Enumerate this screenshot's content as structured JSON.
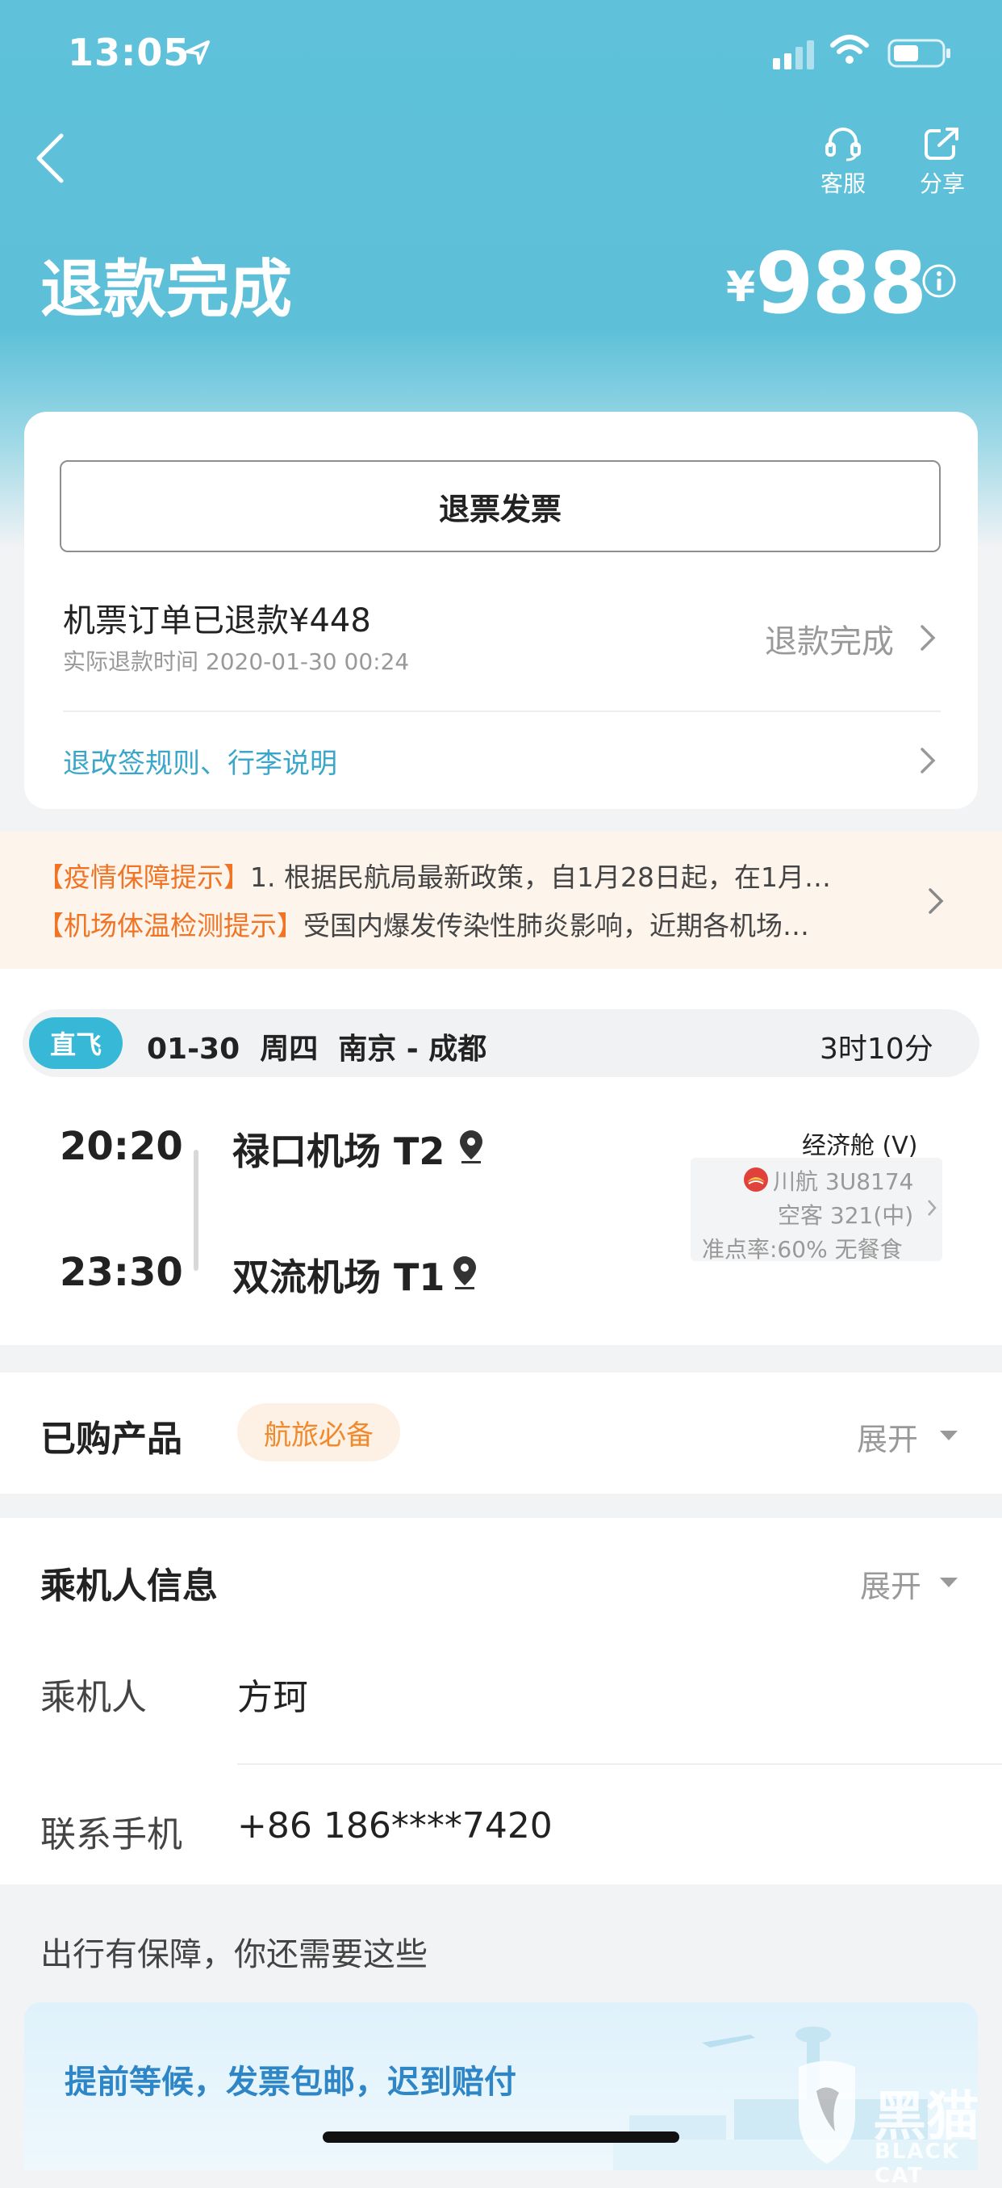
{
  "status_bar": {
    "time": "13:05"
  },
  "header": {
    "customer_service_label": "客服",
    "share_label": "分享",
    "title": "退款完成",
    "price_currency": "¥",
    "price_value": "988"
  },
  "refund_card": {
    "invoice_button": "退票发票",
    "order_refunded": "机票订单已退款¥448",
    "refund_time": "实际退款时间 2020-01-30 00:24",
    "status": "退款完成",
    "rules_link": "退改签规则、行李说明"
  },
  "notices": [
    {
      "tag": "【疫情保障提示】",
      "text": "1. 根据民航局最新政策，自1月28日起，在1月…"
    },
    {
      "tag": "【机场体温检测提示】",
      "text": "受国内爆发传染性肺炎影响，近期各机场…"
    }
  ],
  "flight": {
    "badge": "直飞",
    "summary": "01-30  周四  南京 - 成都",
    "duration": "3时10分",
    "departure_time": "20:20",
    "departure_airport": "禄口机场 T2",
    "arrival_time": "23:30",
    "arrival_airport": "双流机场 T1",
    "cabin": "经济舱 (V)",
    "flight_number": "川航 3U8174",
    "aircraft": "空客 321(中)",
    "on_time": "准点率:60% 无餐食"
  },
  "purchased": {
    "title": "已购产品",
    "tag": "航旅必备",
    "expand": "展开"
  },
  "passenger": {
    "title": "乘机人信息",
    "expand": "展开",
    "passenger_label": "乘机人",
    "passenger_name": "方珂",
    "phone_label": "联系手机",
    "phone_value": "+86 186****7420"
  },
  "extras": {
    "title": "出行有保障，你还需要这些",
    "promo": "提前等候，发票包邮，迟到赔付"
  },
  "watermark": {
    "cn": "黑猫",
    "en": "BLACK CAT"
  },
  "colors": {
    "header": "#5fc1da",
    "accent_blue": "#3aa6c9",
    "notice_orange": "#f07424",
    "badge_blue": "#37b8d6"
  }
}
